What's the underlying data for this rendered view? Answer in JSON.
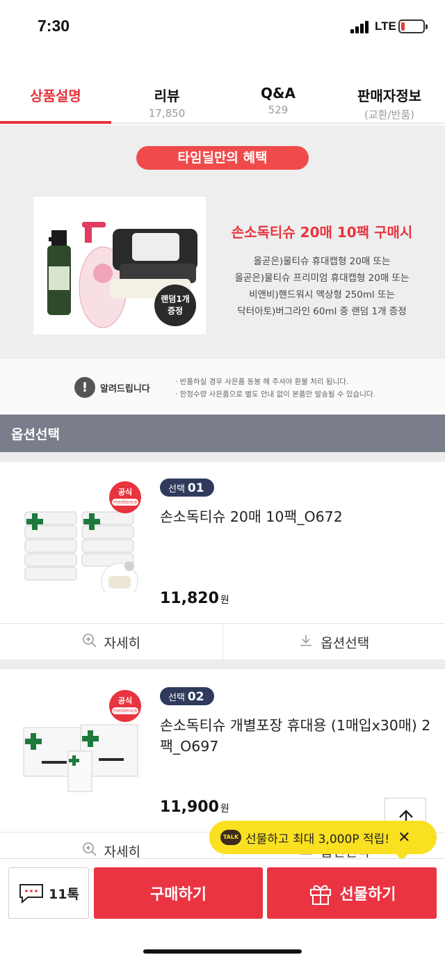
{
  "status": {
    "time": "7:30",
    "network": "LTE"
  },
  "tabs": [
    {
      "label": "상품설명",
      "sub": ""
    },
    {
      "label": "리뷰",
      "sub": "17,850"
    },
    {
      "label": "Q&A",
      "sub": "529"
    },
    {
      "label": "판매자정보",
      "sub": "(교환/반품)"
    }
  ],
  "promo": {
    "pill": "타임딜만의 혜택",
    "title": "손소독티슈 20매 10팩 구매시",
    "desc": [
      "올곧은)물티슈 휴대캡형 20매 또는",
      "올곧은)물티슈 프리미엄 휴대캡형 20매 또는",
      "비앤비)핸드워시 액상형 250ml 또는",
      "닥터아토)버그라인 60ml 중 랜덤 1개 증정"
    ],
    "image_badge": [
      "랜덤1개",
      "증정"
    ]
  },
  "notice": {
    "label": "알려드립니다",
    "lines": [
      "· 반품하실 경우 사은품 동봉 해 주셔야 환불 처리 됩니다.",
      "· 한정수량 사은품으로 별도 안내 없이 본품만 발송될 수 있습니다."
    ]
  },
  "options_header": "옵션선택",
  "products": [
    {
      "badge": "공식",
      "badge_sub": "medience",
      "sel_text": "선택",
      "sel_num": "01",
      "name": "손소독티슈 20매 10팩_O672",
      "price": "11,820",
      "unit": "원"
    },
    {
      "badge": "공식",
      "badge_sub": "medience",
      "sel_text": "선택",
      "sel_num": "02",
      "name": "손소독티슈 개별포장 휴대용 (1매입x30매) 2팩_O697",
      "price": "11,900",
      "unit": "원"
    }
  ],
  "card_actions": {
    "detail": "자세히",
    "select": "옵션선택"
  },
  "talk_tip": {
    "badge": "TALK",
    "text": "선물하고 최대 3,000P 적립!"
  },
  "bottom": {
    "talk_label": "11톡",
    "buy": "구매하기",
    "gift": "선물하기"
  },
  "colors": {
    "accent": "#e8343e",
    "header": "#7a7e8a",
    "tip": "#f9e020",
    "pill_navy": "#2f3a5c"
  }
}
